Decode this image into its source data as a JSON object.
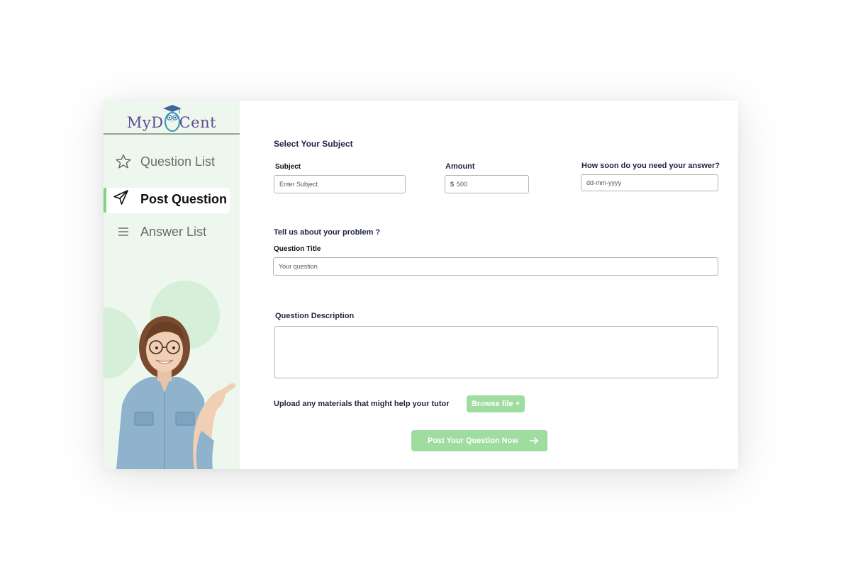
{
  "brand": {
    "logo_text": "MyDoCent",
    "logo_left": "MyD",
    "logo_right": "Cent"
  },
  "sidebar": {
    "items": [
      {
        "label": "Question List",
        "icon": "star-icon",
        "active": false
      },
      {
        "label": "Post Question",
        "icon": "send-icon",
        "active": true
      },
      {
        "label": "Answer List",
        "icon": "menu-icon",
        "active": false
      }
    ]
  },
  "form": {
    "section_subject": "Select Your Subject",
    "subject_label": "Subject",
    "subject_placeholder": "Enter Subject",
    "amount_label": "Amount",
    "amount_currency": "$",
    "amount_value": "500",
    "deadline_label": "How soon do you need your answer?",
    "deadline_placeholder": "dd-mm-yyyy",
    "section_problem": "Tell us about your problem ?",
    "title_label": "Question Title",
    "title_placeholder": "Your question",
    "description_label": "Question Description",
    "upload_label": "Upload any materials that might help your tutor",
    "browse_button": "Browse file +",
    "submit_button": "Post Your Question Now"
  },
  "colors": {
    "accent_green": "#9edc9f",
    "active_bar": "#7fd484",
    "sidebar_bg": "#eef7ee",
    "brand_purple": "#5e4b92",
    "heading_navy": "#1f2544"
  }
}
